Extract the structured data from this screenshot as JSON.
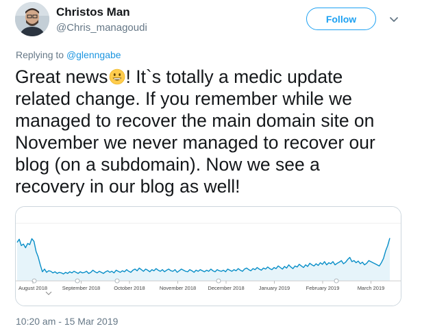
{
  "author": {
    "name": "Christos Man",
    "handle": "@Chris_managoudi"
  },
  "follow_label": "Follow",
  "replying": {
    "prefix": "Replying to ",
    "user": "@glenngabe"
  },
  "tweet": {
    "lines": [
      "Great news",
      "! It`s totally a medic update",
      "related change. If you remember while we",
      "managed to recover the main domain site on",
      "November we never managed to recover our",
      "blog (on a subdomain). Now we see a",
      "recovery in our blog as well!"
    ],
    "emoji": "grinning-face-icon"
  },
  "timestamp": "10:20 am - 15 Mar 2019",
  "colors": {
    "link": "#1b95e0",
    "follow": "#1da1f2",
    "secondary_text": "#657786",
    "chart_line": "#058dc7",
    "chart_fill": "#e6f4fa"
  },
  "chart_data": {
    "type": "area",
    "xlabels": [
      "August 2018",
      "September 2018",
      "October 2018",
      "November 2018",
      "December 2018",
      "January 2019",
      "February 2019",
      "March 2019"
    ],
    "ylim": [
      0,
      100
    ],
    "grid": false,
    "series": [
      {
        "values": [
          72,
          78,
          66,
          69,
          62,
          70,
          68,
          79,
          74,
          55,
          45,
          30,
          17,
          22,
          16,
          19,
          18,
          15,
          17,
          14,
          16,
          15,
          13,
          16,
          14,
          17,
          15,
          18,
          16,
          14,
          17,
          15,
          16,
          18,
          14,
          16,
          20,
          17,
          15,
          18,
          16,
          14,
          17,
          19,
          16,
          18,
          15,
          20,
          18,
          16,
          19,
          17,
          21,
          18,
          16,
          20,
          22,
          19,
          24,
          21,
          18,
          22,
          20,
          17,
          21,
          19,
          23,
          20,
          18,
          21,
          17,
          20,
          22,
          19,
          18,
          21,
          16,
          19,
          22,
          20,
          18,
          17,
          21,
          19,
          16,
          20,
          18,
          21,
          19,
          17,
          20,
          18,
          22,
          19,
          17,
          21,
          19,
          18,
          20,
          17,
          22,
          20,
          18,
          21,
          19,
          23,
          20,
          18,
          22,
          24,
          21,
          19,
          23,
          21,
          25,
          22,
          20,
          24,
          22,
          26,
          23,
          21,
          25,
          23,
          28,
          25,
          22,
          27,
          24,
          30,
          26,
          23,
          28,
          26,
          31,
          28,
          25,
          30,
          27,
          33,
          30,
          28,
          32,
          29,
          34,
          31,
          36,
          30,
          34,
          32,
          36,
          30,
          33,
          35,
          38,
          32,
          35,
          40,
          44,
          36,
          38,
          34,
          37,
          32,
          35,
          30,
          33,
          38,
          36,
          34,
          32,
          30,
          28,
          34,
          42,
          56,
          66,
          80
        ]
      }
    ]
  }
}
